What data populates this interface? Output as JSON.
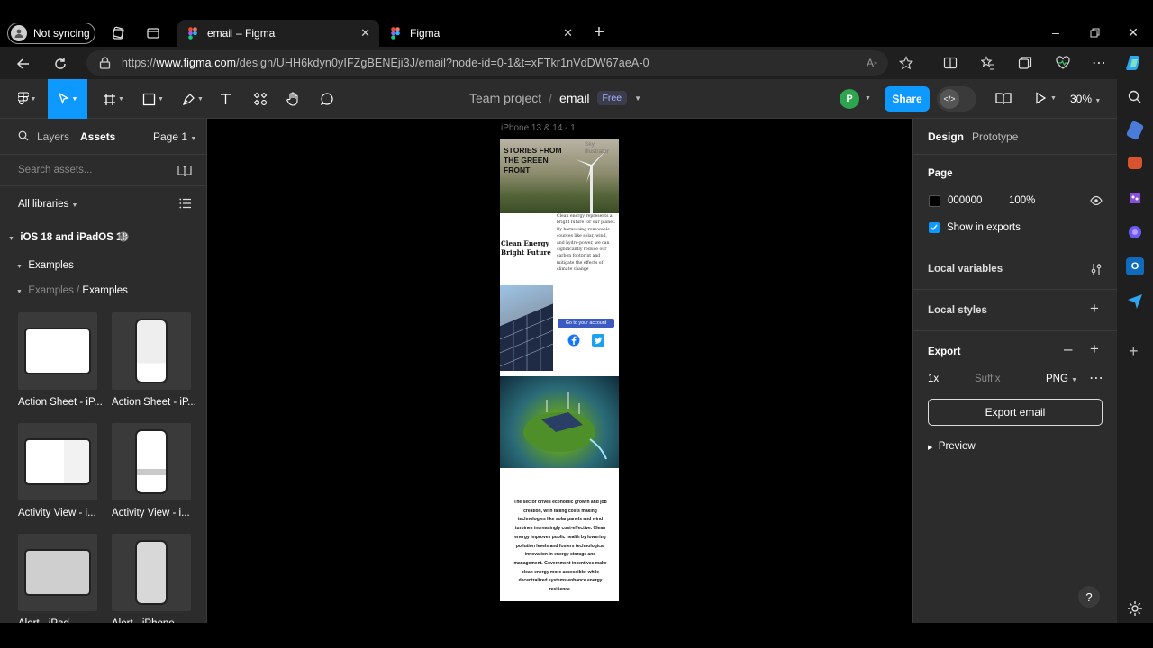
{
  "browser": {
    "profile_label": "Not syncing",
    "tabs": [
      {
        "title": "email – Figma",
        "active": true
      },
      {
        "title": "Figma",
        "active": false
      }
    ],
    "url_prefix": "https://",
    "url_domain": "www.figma.com",
    "url_rest": "/design/UHH6kdyn0yIFZgBENEji3J/email?node-id=0-1&t=xFTkr1nVdDW67aeA-0"
  },
  "toolbar": {
    "project": "Team project",
    "separator": "/",
    "file": "email",
    "plan_badge": "Free",
    "avatar_initial": "P",
    "share_label": "Share",
    "zoom": "30%"
  },
  "left_panel": {
    "tab_layers": "Layers",
    "tab_assets": "Assets",
    "page_selector": "Page 1",
    "search_placeholder": "Search assets...",
    "libraries_label": "All libraries",
    "library_name": "iOS 18 and iPadOS 18",
    "section": "Examples",
    "sub_path_parent": "Examples /",
    "sub_path_child": "Examples",
    "assets": [
      {
        "label": "Action Sheet - iP..."
      },
      {
        "label": "Action Sheet - iP..."
      },
      {
        "label": "Activity View - i..."
      },
      {
        "label": "Activity View - i..."
      },
      {
        "label": "Alert - iPad..."
      },
      {
        "label": "Alert - iPhone..."
      }
    ]
  },
  "canvas": {
    "frame_label": "iPhone 13 & 14 - 1",
    "email": {
      "hero_headline": "STORIES FROM THE GREEN FRONT",
      "hero_sky": "Sky Illustrator",
      "tagline": "Clean Energy Bright Future",
      "intro": "Clean energy represents a bright future for our planet. By harnessing renewable sources like solar, wind, and hydro-power, we can significantly reduce our carbon footprint and mitigate the effects of climate change",
      "cta": "Go to your account",
      "body": "The sector drives economic growth and job creation, with falling costs making technologies like solar panels and wind turbines increasingly cost-effective. Clean energy improves public health by lowering pollution levels and fosters technological innovation in energy storage and management. Government incentives make clean energy more accessible, while decentralized systems enhance energy resilience."
    }
  },
  "right_panel": {
    "tab_design": "Design",
    "tab_prototype": "Prototype",
    "page_section": "Page",
    "page_color": "000000",
    "page_opacity": "100%",
    "show_in_exports": "Show in exports",
    "local_variables": "Local variables",
    "local_styles": "Local styles",
    "export_section": "Export",
    "export_scale": "1x",
    "export_suffix_placeholder": "Suffix",
    "export_format": "PNG",
    "export_button": "Export email",
    "preview": "Preview"
  },
  "help_label": "?",
  "colors": {
    "accent": "#0d99ff",
    "panel_bg": "#2c2c2c",
    "canvas_bg": "#000000",
    "avatar": "#2da44e"
  }
}
